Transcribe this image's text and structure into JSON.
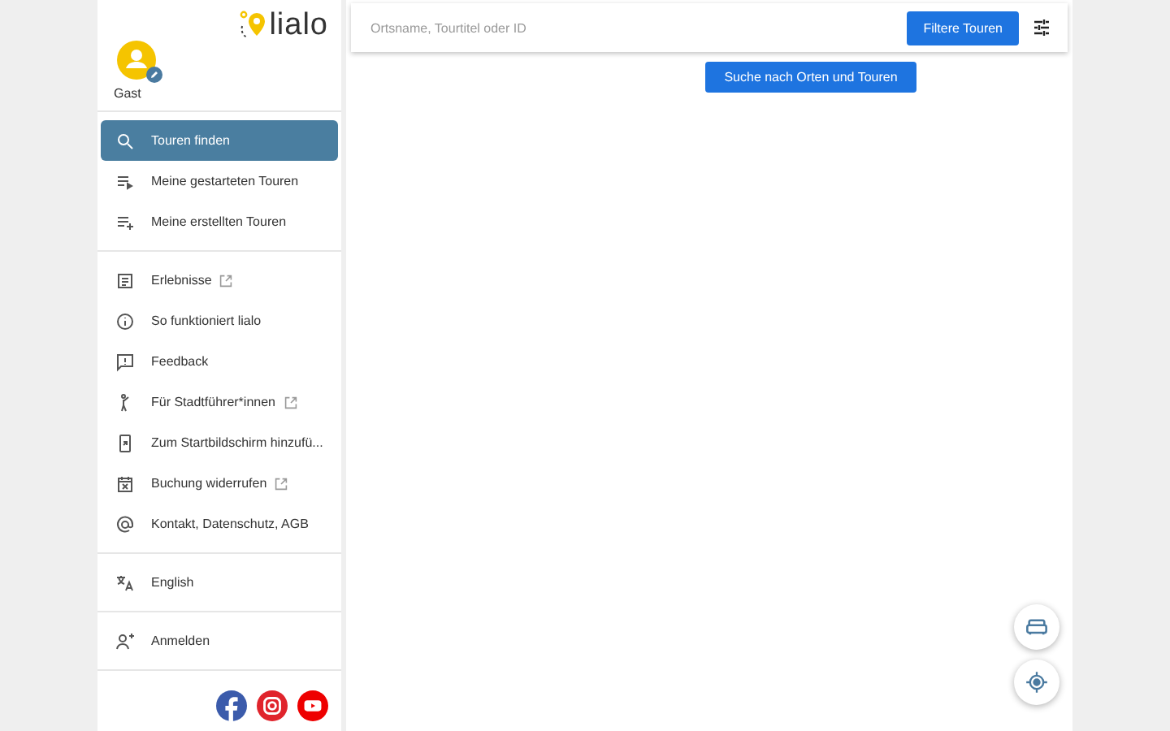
{
  "logo": {
    "text": "lialo"
  },
  "user": {
    "name": "Gast"
  },
  "menu_sections": [
    {
      "items": [
        {
          "label": "Touren finden",
          "selected": true,
          "external": false
        },
        {
          "label": "Meine gestarteten Touren",
          "selected": false,
          "external": false
        },
        {
          "label": "Meine erstellten Touren",
          "selected": false,
          "external": false
        }
      ]
    },
    {
      "items": [
        {
          "label": "Erlebnisse",
          "selected": false,
          "external": true
        },
        {
          "label": "So funktioniert lialo",
          "selected": false,
          "external": false
        },
        {
          "label": "Feedback",
          "selected": false,
          "external": false
        },
        {
          "label": "Für Stadtführer*innen",
          "selected": false,
          "external": true
        },
        {
          "label": "Zum Startbildschirm hinzufü...",
          "selected": false,
          "external": false
        },
        {
          "label": "Buchung widerrufen",
          "selected": false,
          "external": true
        },
        {
          "label": "Kontakt, Datenschutz, AGB",
          "selected": false,
          "external": false
        }
      ]
    },
    {
      "items": [
        {
          "label": "English",
          "selected": false,
          "external": false
        }
      ]
    },
    {
      "items": [
        {
          "label": "Anmelden",
          "selected": false,
          "external": false
        }
      ]
    }
  ],
  "search": {
    "placeholder": "Ortsname, Tourtitel oder ID"
  },
  "filter_tooltip": "Filtere Touren",
  "search_tooltip": "Suche nach Orten und Touren"
}
